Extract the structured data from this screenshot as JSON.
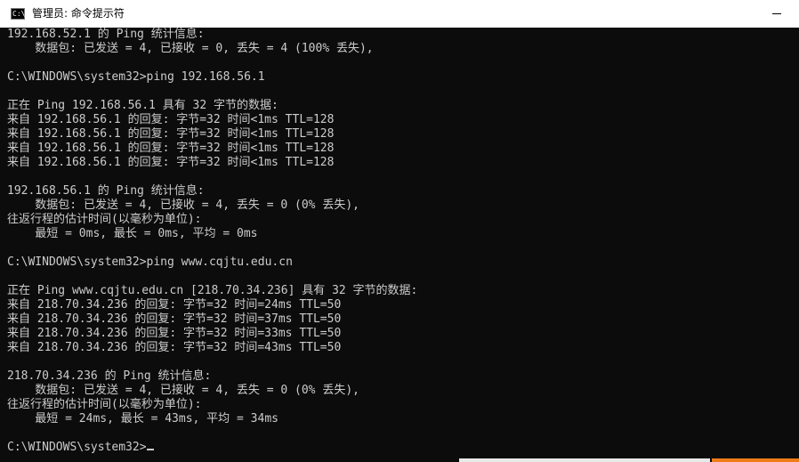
{
  "window": {
    "title": "管理员: 命令提示符",
    "icon": "cmd-icon",
    "icon_glyph": "C:\\"
  },
  "console": {
    "lines": [
      "192.168.52.1 的 Ping 统计信息:",
      "    数据包: 已发送 = 4, 已接收 = 0, 丢失 = 4 (100% 丢失),",
      "",
      "C:\\WINDOWS\\system32>ping 192.168.56.1",
      "",
      "正在 Ping 192.168.56.1 具有 32 字节的数据:",
      "来自 192.168.56.1 的回复: 字节=32 时间<1ms TTL=128",
      "来自 192.168.56.1 的回复: 字节=32 时间<1ms TTL=128",
      "来自 192.168.56.1 的回复: 字节=32 时间<1ms TTL=128",
      "来自 192.168.56.1 的回复: 字节=32 时间<1ms TTL=128",
      "",
      "192.168.56.1 的 Ping 统计信息:",
      "    数据包: 已发送 = 4, 已接收 = 4, 丢失 = 0 (0% 丢失),",
      "往返行程的估计时间(以毫秒为单位):",
      "    最短 = 0ms, 最长 = 0ms, 平均 = 0ms",
      "",
      "C:\\WINDOWS\\system32>ping www.cqjtu.edu.cn",
      "",
      "正在 Ping www.cqjtu.edu.cn [218.70.34.236] 具有 32 字节的数据:",
      "来自 218.70.34.236 的回复: 字节=32 时间=24ms TTL=50",
      "来自 218.70.34.236 的回复: 字节=32 时间=37ms TTL=50",
      "来自 218.70.34.236 的回复: 字节=32 时间=33ms TTL=50",
      "来自 218.70.34.236 的回复: 字节=32 时间=43ms TTL=50",
      "",
      "218.70.34.236 的 Ping 统计信息:",
      "    数据包: 已发送 = 4, 已接收 = 4, 丢失 = 0 (0% 丢失),",
      "往返行程的估计时间(以毫秒为单位):",
      "    最短 = 24ms, 最长 = 43ms, 平均 = 34ms",
      "",
      "C:\\WINDOWS\\system32>"
    ]
  },
  "colors": {
    "console_background": "#0c0c0c",
    "console_text": "#cccccc",
    "titlebar_background": "#ffffff"
  }
}
